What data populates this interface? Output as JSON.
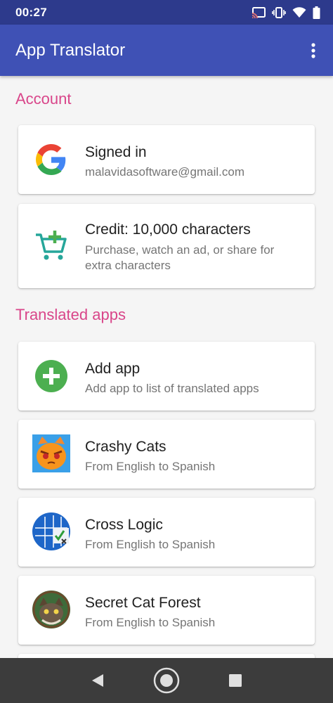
{
  "status_bar": {
    "time": "00:27"
  },
  "app_bar": {
    "title": "App Translator"
  },
  "sections": {
    "account": "Account",
    "translated_apps": "Translated apps"
  },
  "account": {
    "signed_in": {
      "title": "Signed in",
      "subtitle": "malavidasoftware@gmail.com"
    },
    "credit": {
      "title": "Credit: 10,000 characters",
      "subtitle": "Purchase, watch an ad, or share for extra characters"
    }
  },
  "apps": {
    "add": {
      "title": "Add app",
      "subtitle": "Add app to list of translated apps"
    },
    "items": [
      {
        "title": "Crashy Cats",
        "subtitle": "From English to Spanish",
        "icon": "crashy-cats-app-icon"
      },
      {
        "title": "Cross Logic",
        "subtitle": "From English to Spanish",
        "icon": "cross-logic-app-icon"
      },
      {
        "title": "Secret Cat Forest",
        "subtitle": "From English to Spanish",
        "icon": "secret-cat-forest-app-icon"
      }
    ]
  },
  "colors": {
    "app_bar": "#3f51b5",
    "status_bar": "#2d3a8c",
    "section_header": "#d9468a",
    "add_icon": "#4caf50",
    "cart_icon": "#26a69a"
  }
}
